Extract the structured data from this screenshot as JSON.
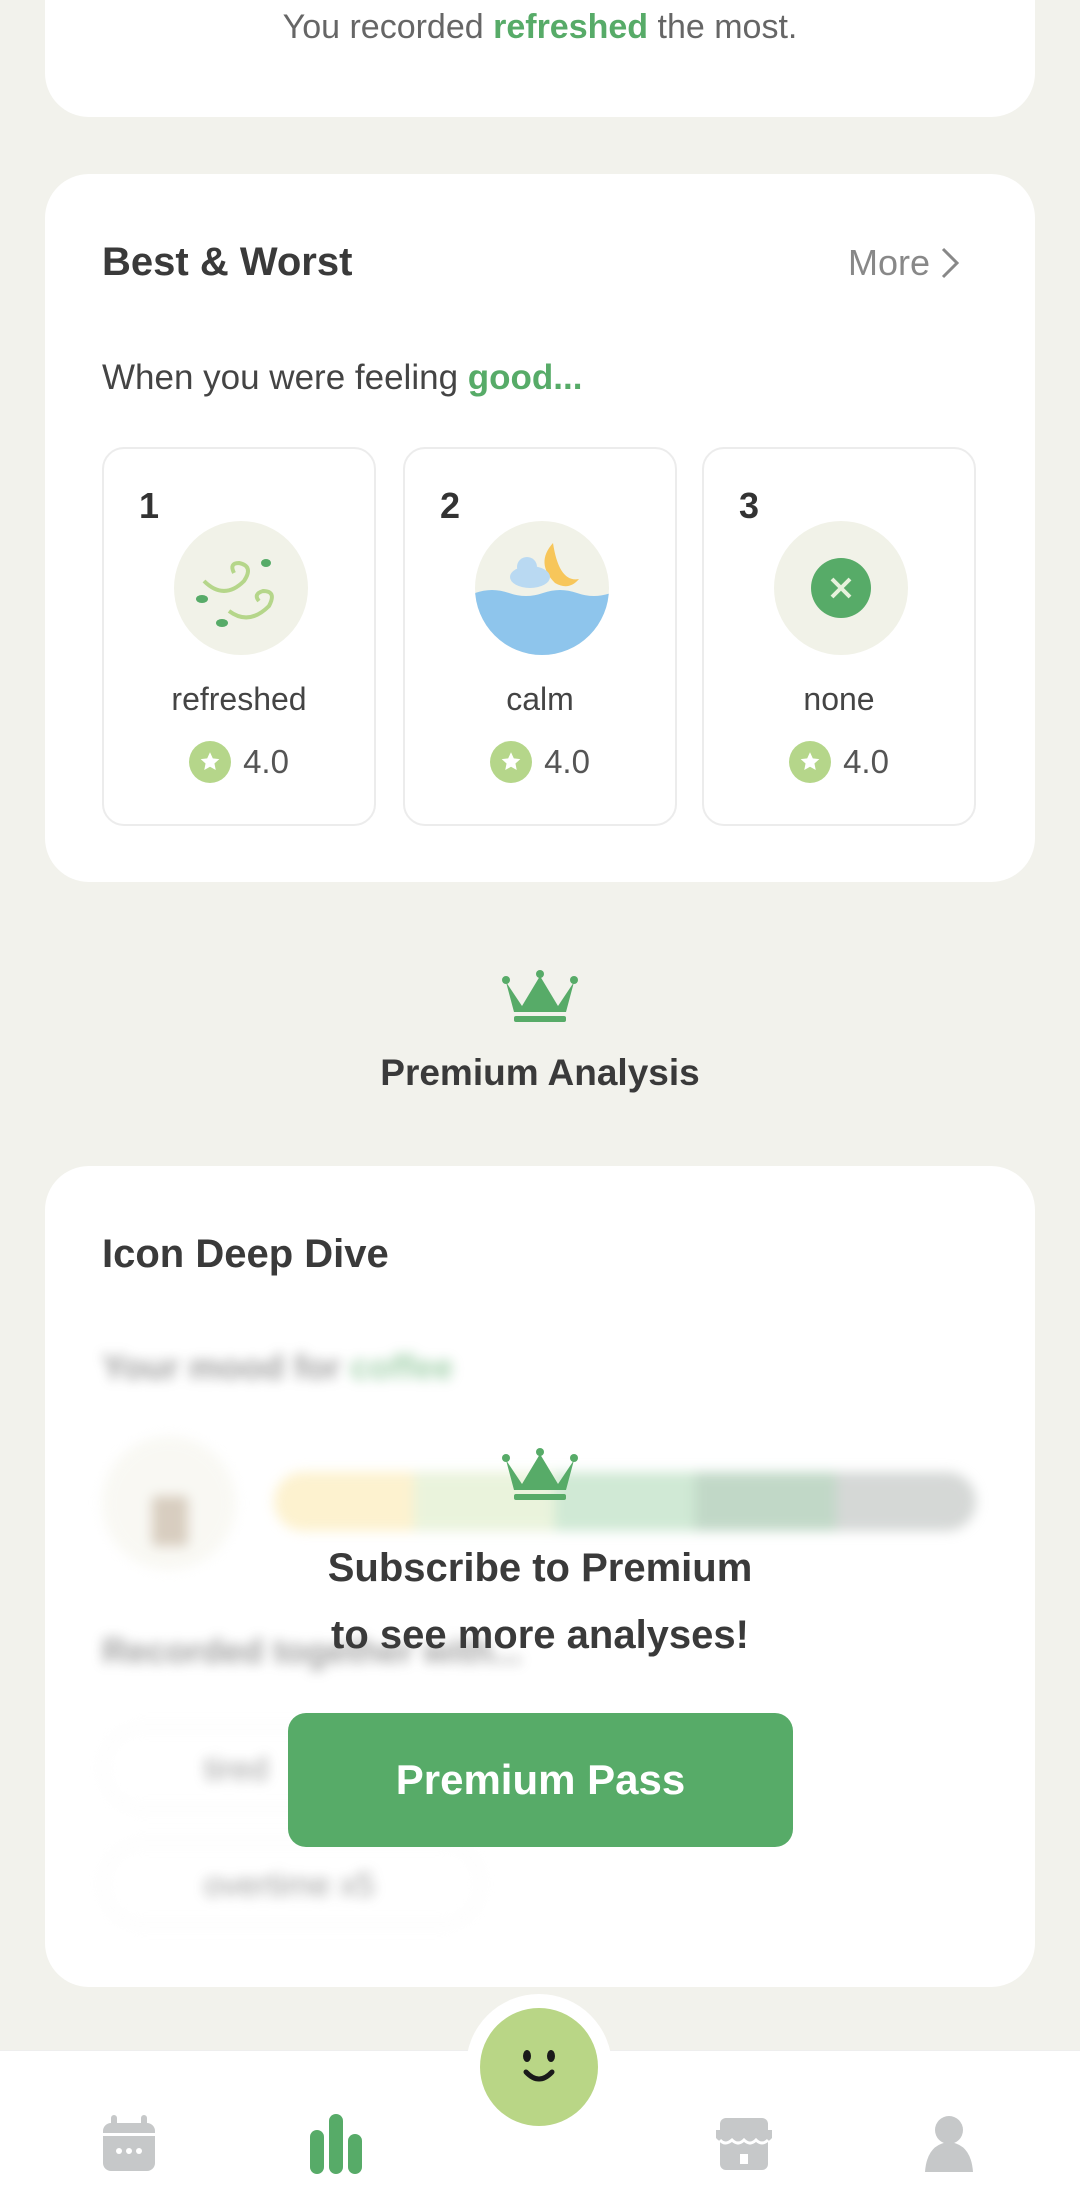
{
  "top_card": {
    "prefix": "You recorded ",
    "highlight": "refreshed",
    "suffix": " the most."
  },
  "best_worst": {
    "title": "Best & Worst",
    "more_label": "More",
    "feeling_prefix": "When you were feeling ",
    "feeling_highlight": "good...",
    "items": [
      {
        "rank": "1",
        "label": "refreshed",
        "rating": "4.0",
        "icon": "wind-icon"
      },
      {
        "rank": "2",
        "label": "calm",
        "rating": "4.0",
        "icon": "calm-sea-moon-icon"
      },
      {
        "rank": "3",
        "label": "none",
        "rating": "4.0",
        "icon": "none-x-icon"
      }
    ]
  },
  "premium_analysis": {
    "title": "Premium Analysis"
  },
  "deep_dive": {
    "title": "Icon Deep Dive",
    "mood_prefix": "Your mood for ",
    "mood_highlight": "coffee",
    "recorded_label": "Recorded together with...",
    "list": [
      "tired",
      "overtime x5"
    ],
    "mood_bar_colors": [
      "#fbe7a8",
      "#d9eac0",
      "#a9d7b2",
      "#8fb99a",
      "#b3b8b5"
    ]
  },
  "overlay": {
    "line1": "Subscribe to Premium",
    "line2": "to see more analyses!",
    "button": "Premium Pass"
  },
  "nav": {
    "items": [
      "calendar-icon",
      "stats-icon",
      "record-mood-icon",
      "store-icon",
      "profile-icon"
    ],
    "active": "stats-icon"
  },
  "colors": {
    "accent": "#57ab68",
    "background": "#f2f2ec",
    "inactive": "#c6c8c9"
  }
}
